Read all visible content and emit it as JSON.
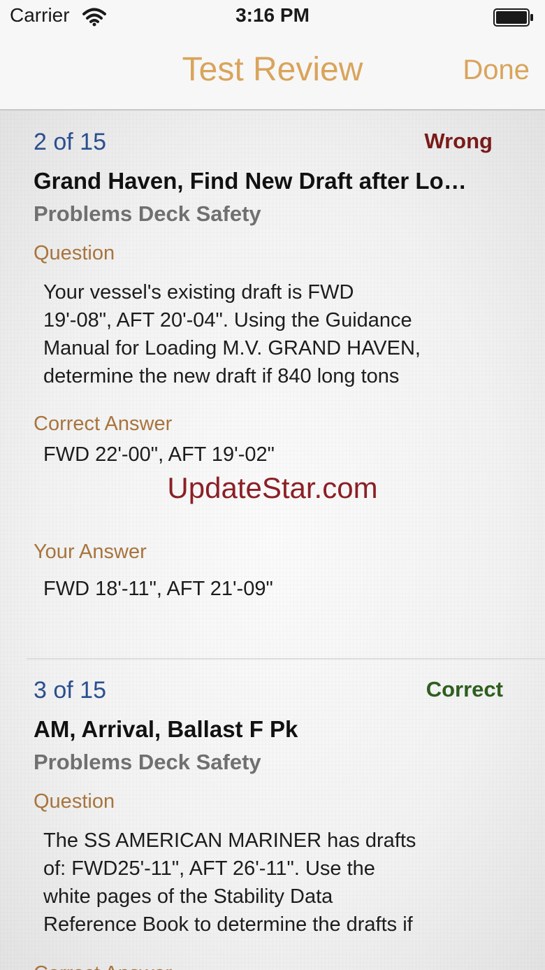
{
  "status_bar": {
    "carrier": "Carrier",
    "time": "3:16 PM"
  },
  "nav": {
    "title": "Test Review",
    "done_label": "Done"
  },
  "watermark": "UpdateStar.com",
  "items": [
    {
      "counter": "2 of 15",
      "status": "Wrong",
      "status_color": "#7a1a1a",
      "title": "Grand Haven, Find New Draft after Lo…",
      "category": "Problems Deck Safety",
      "question_label": "Question",
      "question_lines": [
        "Your vessel's existing draft is FWD",
        "19'-08\", AFT 20'-04\". Using the Guidance",
        "Manual for Loading M.V. GRAND HAVEN,",
        "determine the new draft if 840 long tons"
      ],
      "correct_label": "Correct Answer",
      "correct_answer": "FWD 22'-00\", AFT 19'-02\"",
      "your_label": "Your Answer",
      "your_answer": "FWD 18'-11\", AFT 21'-09\""
    },
    {
      "counter": "3 of 15",
      "status": "Correct",
      "status_color": "#2e5e1e",
      "title": "AM, Arrival, Ballast F Pk",
      "category": "Problems Deck Safety",
      "question_label": "Question",
      "question_lines": [
        "The SS AMERICAN MARINER has drafts",
        "of: FWD25'-11\", AFT 26'-11\". Use the",
        "white pages of the Stability Data",
        "Reference Book to determine the drafts if"
      ],
      "correct_label": "Correct Answer"
    }
  ]
}
